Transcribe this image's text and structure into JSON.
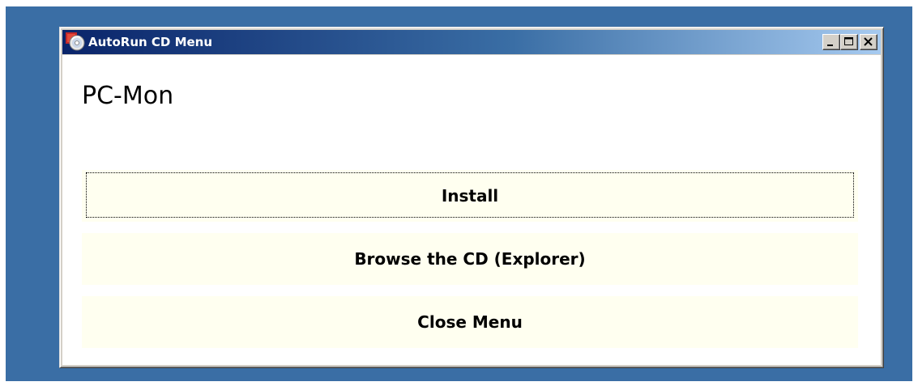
{
  "window": {
    "title": "AutoRun CD Menu"
  },
  "content": {
    "app_name": "PC-Mon",
    "buttons": [
      {
        "label": "Install"
      },
      {
        "label": "Browse the CD (Explorer)"
      },
      {
        "label": "Close Menu"
      }
    ]
  },
  "icons": {
    "app": "cd-autorun-icon",
    "minimize": "minimize-icon",
    "maximize": "maximize-icon",
    "close": "close-icon"
  },
  "colors": {
    "desktop": "#3a6ea5",
    "titlebar_start": "#0a246a",
    "titlebar_end": "#a6caf0",
    "button_bg": "#fffff0"
  }
}
